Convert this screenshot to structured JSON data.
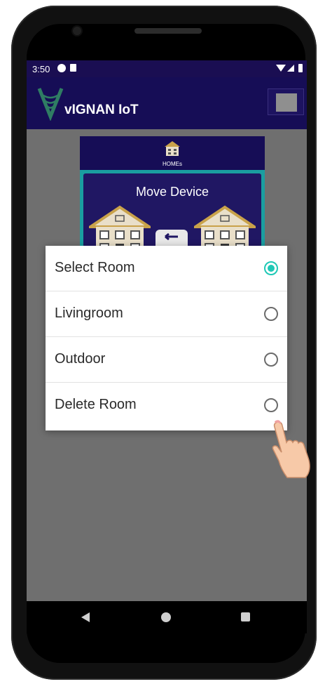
{
  "status_bar": {
    "time": "3:50"
  },
  "app_bar": {
    "title": "vIGNAN IoT"
  },
  "card": {
    "homes_label": "HOMEs",
    "move_title": "Move Device"
  },
  "dialog": {
    "options": [
      {
        "label": "Select Room",
        "selected": true
      },
      {
        "label": "Livingroom",
        "selected": false
      },
      {
        "label": "Outdoor",
        "selected": false
      },
      {
        "label": "Delete Room",
        "selected": false
      }
    ]
  },
  "colors": {
    "app_bar": "#160d56",
    "status_bar": "#1a0e52",
    "radio_selected": "#1fc8b6",
    "scrim": "#6f6f6f"
  },
  "icons": {
    "logo": "vignan-logo-icon",
    "menu": "menu-icon",
    "homes": "house-icon",
    "move": "move-arrows-icon",
    "nav_back": "back-icon",
    "nav_home": "home-icon",
    "nav_recent": "recent-apps-icon",
    "pointer": "pointing-hand-icon"
  }
}
